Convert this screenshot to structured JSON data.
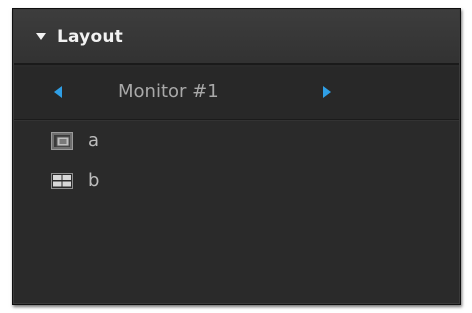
{
  "panel": {
    "title": "Layout"
  },
  "monitor": {
    "label": "Monitor #1"
  },
  "layouts": [
    {
      "label": "a",
      "icon": "picture-in-picture-layout-icon"
    },
    {
      "label": "b",
      "icon": "grid-2x2-layout-icon"
    }
  ],
  "colors": {
    "panel_bg": "#2a2a2a",
    "header_bg": "#363636",
    "accent_arrow": "#2f9fe6",
    "text_primary": "#f2f2f2",
    "text_secondary": "#a9a9a9"
  }
}
